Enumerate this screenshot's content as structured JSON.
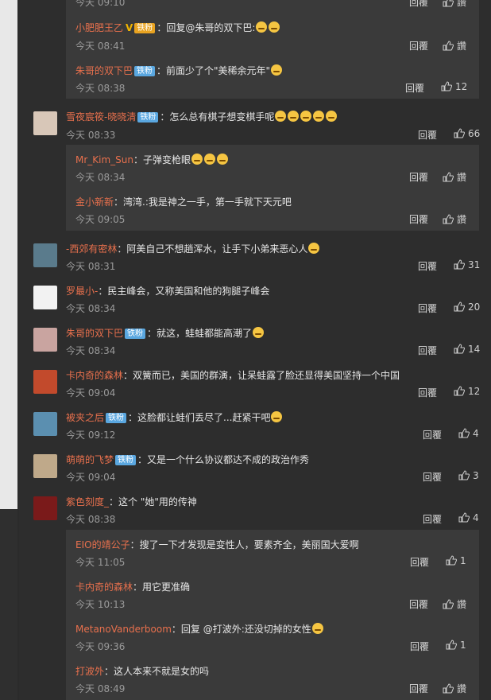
{
  "comments": [
    {
      "type": "reply-box-start",
      "replies": [
        {
          "name": "",
          "text": "",
          "time": "今天 09:10",
          "reply": "回覆",
          "likes": "讚"
        },
        {
          "name": "小肥肥王乙",
          "vip": "V",
          "badge": "铁粉",
          "text": "：回复@朱哥的双下巴:",
          "time": "今天 08:41",
          "reply": "回覆",
          "likes": "讚"
        },
        {
          "name": "朱哥的双下巴",
          "badge": "铁粉",
          "text": "：前面少了个\"美稀余元年\"",
          "time": "今天 08:38",
          "reply": "回覆",
          "likes": "12"
        }
      ]
    }
  ],
  "top_comments": [
    {
      "name": "雪夜宸筱-晓晓清",
      "badge": "铁粉",
      "text": "：怎么总有棋子想变棋手呢",
      "time": "今天 08:33",
      "reply": "回覆",
      "likes": "66",
      "avatar": "#d8c7b8"
    },
    {
      "name": "-西郊有密林",
      "text": "：阿美自己不想趟浑水，让手下小弟来恶心人",
      "time": "今天 08:31",
      "reply": "回覆",
      "likes": "31",
      "avatar": "#5a7b8c"
    },
    {
      "name": "罗最小-",
      "text": "：民主峰会，又称美国和他的狗腿子峰会",
      "time": "今天 08:34",
      "reply": "回覆",
      "likes": "20",
      "avatar": "#f2f2f2"
    },
    {
      "name": "朱哥的双下巴",
      "badge": "铁粉",
      "text": "：就这，蛙蛙都能高潮了",
      "time": "今天 08:34",
      "reply": "回覆",
      "likes": "14",
      "avatar": "#c9a4a0"
    },
    {
      "name": "卡内奇的森林",
      "text": "：双簧而已，美国的群演，让呆蛙露了脸还显得美国坚持一个中国",
      "time": "今天 09:04",
      "reply": "回覆",
      "likes": "12",
      "avatar": "#c24a2c"
    },
    {
      "name": "被夹之后",
      "badge": "铁粉",
      "text": "：这脸都让蛙们丢尽了...赶紧干吧",
      "time": "今天 09:12",
      "reply": "回覆",
      "likes": "4",
      "avatar": "#5b8fb0"
    },
    {
      "name": "萌萌的飞梦",
      "badge": "铁粉",
      "text": "：又是一个什么协议都达不成的政治作秀",
      "time": "今天 09:04",
      "reply": "回覆",
      "likes": "3",
      "avatar": "#bfa98a"
    },
    {
      "name": "紫色刻度_",
      "text": "：这个 \"她\"用的传神",
      "time": "今天 08:38",
      "reply": "回覆",
      "likes": "4",
      "avatar": "#7a1a1a"
    }
  ],
  "sub_replies_a": [
    {
      "name": "Mr_Kim_Sun",
      "text": "：子弹变枪眼",
      "time": "今天 08:34",
      "reply": "回覆",
      "likes": "讚"
    },
    {
      "name": "金小新新",
      "text": "：湾湾.:我是神之一手，第一手就下天元吧",
      "time": "今天 09:05",
      "reply": "回覆",
      "likes": "讚"
    }
  ],
  "sub_replies_b": [
    {
      "name": "EIO的靖公子",
      "text": "：搜了一下才发现是变性人，要素齐全，美丽国大爱啊",
      "time": "今天 11:05",
      "reply": "回覆",
      "likes": "1"
    },
    {
      "name": "卡内奇的森林",
      "text": "：用它更准确",
      "time": "今天 10:13",
      "reply": "回覆",
      "likes": "讚"
    },
    {
      "name": "MetanoVanderboom",
      "text": "：回复 @打波外:",
      "extra": "还没切掉的女性",
      "time": "今天 09:36",
      "reply": "回覆",
      "likes": "1"
    },
    {
      "name": "打波外",
      "text": "：这人本来不就是女的吗",
      "time": "今天 08:49",
      "reply": "回覆",
      "likes": "讚"
    }
  ],
  "colors": {
    "bg": "#2b2b2b",
    "reply_bg": "#3a3a3a",
    "name": "#e8704d",
    "badge": "#5aa7e0"
  }
}
